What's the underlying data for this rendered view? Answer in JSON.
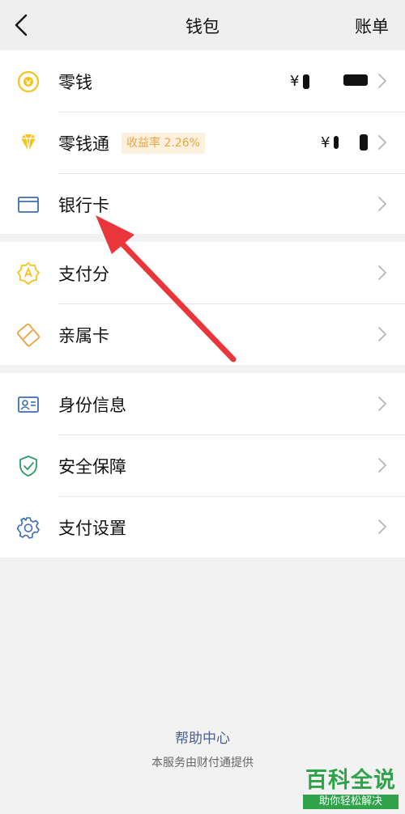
{
  "header": {
    "title": "钱包",
    "bill_label": "账单"
  },
  "groups": {
    "assets": {
      "change": {
        "label": "零钱",
        "amount": "¥"
      },
      "lct": {
        "label": "零钱通",
        "badge": "收益率 2.26%",
        "amount": "¥"
      },
      "bank_card": {
        "label": "银行卡"
      }
    },
    "credit": {
      "pay_score": {
        "label": "支付分"
      },
      "family_card": {
        "label": "亲属卡"
      }
    },
    "settings": {
      "identity": {
        "label": "身份信息"
      },
      "security": {
        "label": "安全保障"
      },
      "pay_settings": {
        "label": "支付设置"
      }
    }
  },
  "footer": {
    "help": "帮助中心",
    "provider": "本服务由财付通提供"
  },
  "watermark": {
    "main": "百科全说",
    "sub": "助你轻松解决"
  },
  "colors": {
    "accent_yellow": "#f5c31a",
    "accent_blue": "#3d6db5",
    "accent_green": "#2f9a6a",
    "badge_bg": "#fdf0dc",
    "badge_text": "#e6a546",
    "arrow_red": "#e8363b",
    "help_link": "#4a5f8f"
  },
  "icons": {
    "back": "chevron-left-icon",
    "change": "coin-icon",
    "lct": "diamond-icon",
    "bank_card": "card-icon",
    "pay_score": "badge-icon",
    "family_card": "family-card-icon",
    "identity": "id-card-icon",
    "security": "shield-check-icon",
    "pay_settings": "gear-icon",
    "chevron": "chevron-right-icon"
  }
}
